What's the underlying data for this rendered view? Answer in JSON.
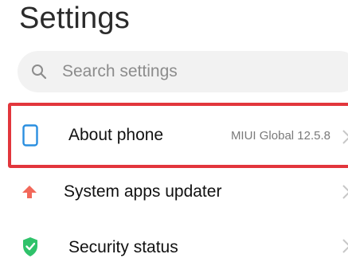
{
  "header": {
    "title": "Settings"
  },
  "search": {
    "placeholder": "Search settings",
    "icon": "search-icon"
  },
  "items": [
    {
      "label": "About phone",
      "value": "MIUI Global 12.5.8",
      "icon": "phone-icon",
      "icon_color": "#2a8fe0",
      "highlighted": true
    },
    {
      "label": "System apps updater",
      "icon": "arrow-up-icon",
      "icon_color": "#f2685a"
    },
    {
      "label": "Security status",
      "icon": "shield-check-icon",
      "icon_color": "#2fc26a"
    }
  ],
  "colors": {
    "highlight_border": "#e2363c",
    "search_bg": "#f2f2f2"
  }
}
